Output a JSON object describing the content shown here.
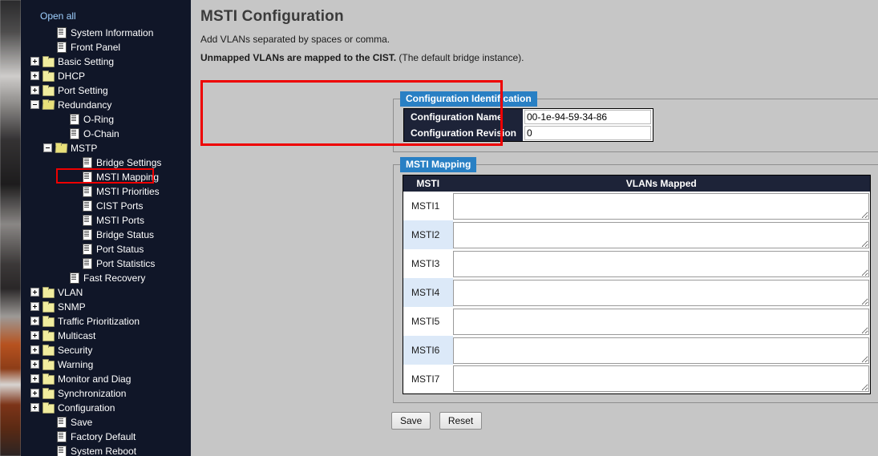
{
  "sidebar": {
    "open_all_label": "Open all",
    "items": [
      {
        "label": "System Information",
        "icon": "page-icon",
        "depth": 1,
        "toggle": "none"
      },
      {
        "label": "Front Panel",
        "icon": "page-icon",
        "depth": 1,
        "toggle": "none"
      },
      {
        "label": "Basic Setting",
        "icon": "folder-icon",
        "depth": 0,
        "toggle": "plus"
      },
      {
        "label": "DHCP",
        "icon": "folder-icon",
        "depth": 0,
        "toggle": "plus"
      },
      {
        "label": "Port Setting",
        "icon": "folder-icon",
        "depth": 0,
        "toggle": "plus"
      },
      {
        "label": "Redundancy",
        "icon": "folder-open-icon",
        "depth": 0,
        "toggle": "minus"
      },
      {
        "label": "O-Ring",
        "icon": "page-icon",
        "depth": 2,
        "toggle": "none"
      },
      {
        "label": "O-Chain",
        "icon": "page-icon",
        "depth": 2,
        "toggle": "none"
      },
      {
        "label": "MSTP",
        "icon": "folder-open-icon",
        "depth": 1,
        "toggle": "minus"
      },
      {
        "label": "Bridge Settings",
        "icon": "page-icon",
        "depth": 3,
        "toggle": "none"
      },
      {
        "label": "MSTI Mapping",
        "icon": "page-icon",
        "depth": 3,
        "toggle": "none",
        "highlighted": true
      },
      {
        "label": "MSTI Priorities",
        "icon": "page-icon",
        "depth": 3,
        "toggle": "none"
      },
      {
        "label": "CIST Ports",
        "icon": "page-icon",
        "depth": 3,
        "toggle": "none"
      },
      {
        "label": "MSTI Ports",
        "icon": "page-icon",
        "depth": 3,
        "toggle": "none"
      },
      {
        "label": "Bridge Status",
        "icon": "page-icon",
        "depth": 3,
        "toggle": "none"
      },
      {
        "label": "Port Status",
        "icon": "page-icon",
        "depth": 3,
        "toggle": "none"
      },
      {
        "label": "Port Statistics",
        "icon": "page-icon",
        "depth": 3,
        "toggle": "none"
      },
      {
        "label": "Fast Recovery",
        "icon": "page-icon",
        "depth": 2,
        "toggle": "none"
      },
      {
        "label": "VLAN",
        "icon": "folder-icon",
        "depth": 0,
        "toggle": "plus"
      },
      {
        "label": "SNMP",
        "icon": "folder-icon",
        "depth": 0,
        "toggle": "plus"
      },
      {
        "label": "Traffic Prioritization",
        "icon": "folder-icon",
        "depth": 0,
        "toggle": "plus"
      },
      {
        "label": "Multicast",
        "icon": "folder-icon",
        "depth": 0,
        "toggle": "plus"
      },
      {
        "label": "Security",
        "icon": "folder-icon",
        "depth": 0,
        "toggle": "plus"
      },
      {
        "label": "Warning",
        "icon": "folder-icon",
        "depth": 0,
        "toggle": "plus"
      },
      {
        "label": "Monitor and Diag",
        "icon": "folder-icon",
        "depth": 0,
        "toggle": "plus"
      },
      {
        "label": "Synchronization",
        "icon": "folder-icon",
        "depth": 0,
        "toggle": "plus"
      },
      {
        "label": "Configuration",
        "icon": "folder-icon",
        "depth": 0,
        "toggle": "plus"
      },
      {
        "label": "Save",
        "icon": "page-icon",
        "depth": 1,
        "toggle": "none"
      },
      {
        "label": "Factory Default",
        "icon": "page-icon",
        "depth": 1,
        "toggle": "none"
      },
      {
        "label": "System Reboot",
        "icon": "page-icon",
        "depth": 1,
        "toggle": "none"
      }
    ]
  },
  "main": {
    "title": "MSTI Configuration",
    "hint_line": "Add VLANs separated by spaces or comma.",
    "note_bold": "Unmapped VLANs are mapped to the CIST.",
    "note_rest": " (The default bridge instance).",
    "config_identification": {
      "legend": "Configuration Identification",
      "rows": [
        {
          "label": "Configuration Name",
          "value": "00-1e-94-59-34-86"
        },
        {
          "label": "Configuration Revision",
          "value": "0"
        }
      ]
    },
    "msti_mapping": {
      "legend": "MSTI Mapping",
      "columns": [
        "MSTI",
        "VLANs Mapped"
      ],
      "rows": [
        {
          "msti": "MSTI1",
          "vlans": ""
        },
        {
          "msti": "MSTI2",
          "vlans": ""
        },
        {
          "msti": "MSTI3",
          "vlans": ""
        },
        {
          "msti": "MSTI4",
          "vlans": ""
        },
        {
          "msti": "MSTI5",
          "vlans": ""
        },
        {
          "msti": "MSTI6",
          "vlans": ""
        },
        {
          "msti": "MSTI7",
          "vlans": ""
        }
      ]
    },
    "buttons": {
      "save": "Save",
      "reset": "Reset"
    }
  },
  "colors": {
    "legend_blue": "#2980c4",
    "header_navy": "#1d2338",
    "highlight_red": "#ee0000",
    "row_alt_blue": "#dce9f8",
    "page_bg": "#c6c6c6",
    "sidebar_bg": "#101628"
  }
}
